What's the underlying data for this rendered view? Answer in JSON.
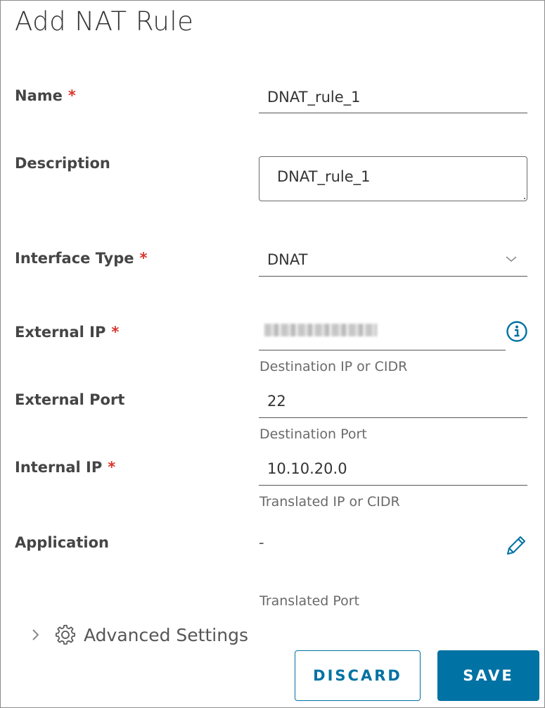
{
  "dialog": {
    "title": "Add NAT Rule",
    "required_marker": "*"
  },
  "form": {
    "name": {
      "label": "Name",
      "value": "DNAT_rule_1"
    },
    "description": {
      "label": "Description",
      "value": "DNAT_rule_1"
    },
    "interface_type": {
      "label": "Interface Type",
      "value": "DNAT"
    },
    "external_ip": {
      "label": "External IP",
      "helper": "Destination IP or CIDR"
    },
    "external_port": {
      "label": "External Port",
      "value": "22",
      "helper": "Destination Port"
    },
    "internal_ip": {
      "label": "Internal IP",
      "value": "10.10.20.0",
      "helper": "Translated IP or CIDR"
    },
    "application": {
      "label": "Application",
      "value": "-",
      "helper": "Translated Port"
    }
  },
  "advanced": {
    "label": "Advanced Settings"
  },
  "buttons": {
    "discard": "DISCARD",
    "save": "SAVE"
  },
  "icons": {
    "info": "info-icon",
    "edit": "pencil-icon",
    "expand": "chevron-right-icon",
    "settings": "gear-icon",
    "dropdown": "chevron-down-icon"
  },
  "colors": {
    "primary": "#0072a3",
    "required": "#d9372c",
    "text": "#333333",
    "helper": "#6a6a6a"
  }
}
